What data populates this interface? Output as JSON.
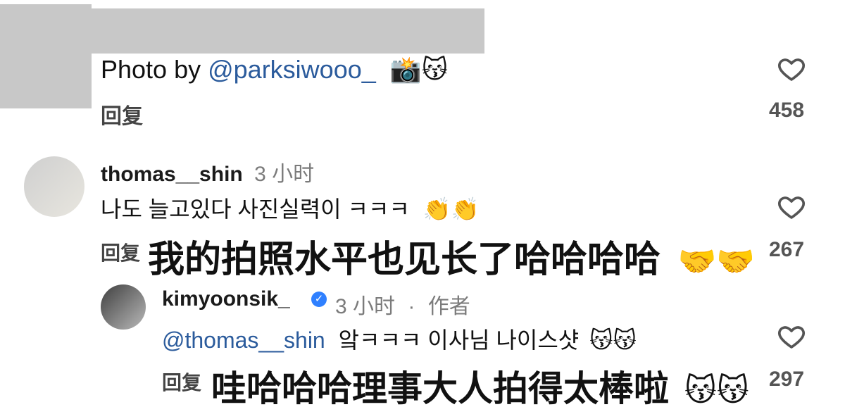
{
  "top_comment": {
    "text_prefix": "Photo by ",
    "mention": "@parksiwooo_",
    "emoji": "📸😽",
    "reply_label": "回复",
    "likes": "458"
  },
  "comment_thomas": {
    "username": "thomas__shin",
    "timestamp": "3 小时",
    "text_korean": "나도 늘고있다 사진실력이 ㅋㅋㅋ",
    "text_emoji": "👏👏",
    "reply_label": "回复",
    "translation": "我的拍照水平也见长了哈哈哈哈",
    "translation_emoji": "🤝🤝",
    "likes": "267"
  },
  "reply_kimyoonsik": {
    "username": "kimyoonsik_",
    "verified_icon": "✓",
    "timestamp": "3 小时",
    "separator": "·",
    "author_badge": "作者",
    "mention": "@thomas__shin",
    "text_korean": "앜ㅋㅋㅋ 이사님 나이스샷",
    "text_emoji": "😽😽",
    "reply_label": "回复",
    "translation": "哇哈哈哈理事大人拍得太棒啦",
    "translation_emoji": "😽😽",
    "likes": "297"
  },
  "icons": {
    "heart": "heart-icon",
    "verified": "verified-badge-icon"
  },
  "colors": {
    "link": "#2b5b9c",
    "muted": "#7b7b7b",
    "verified": "#2f80ff"
  }
}
